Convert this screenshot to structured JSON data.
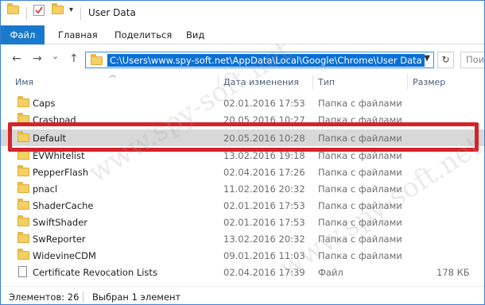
{
  "window": {
    "title": "User Data"
  },
  "ribbon": {
    "tabs": [
      {
        "label": "Файл"
      },
      {
        "label": "Главная"
      },
      {
        "label": "Поделиться"
      },
      {
        "label": "Вид"
      }
    ]
  },
  "nav": {
    "back_icon": "←",
    "forward_icon": "→",
    "recent_icon": "⌄",
    "up_icon": "↑",
    "address": "C:\\Users\\www.spy-soft.net\\AppData\\Local\\Google\\Chrome\\User Data",
    "refresh_icon": "↻",
    "search_placeholder": "Пои"
  },
  "columns": {
    "name": "Имя",
    "date": "Дата изменения",
    "type": "Тип",
    "size": "Размер"
  },
  "rows": [
    {
      "name": "Caps",
      "date": "02.01.2016 17:53",
      "type": "Папка с файлами",
      "size": "",
      "kind": "folder"
    },
    {
      "name": "Crashpad",
      "date": "20.05.2016 10:27",
      "type": "Папка с файлами",
      "size": "",
      "kind": "folder"
    },
    {
      "name": "Default",
      "date": "20.05.2016 10:28",
      "type": "Папка с файлами",
      "size": "",
      "kind": "folder",
      "selected": true
    },
    {
      "name": "EVWhitelist",
      "date": "13.02.2016 19:18",
      "type": "Папка с файлами",
      "size": "",
      "kind": "folder"
    },
    {
      "name": "PepperFlash",
      "date": "02.04.2016 17:26",
      "type": "Папка с файлами",
      "size": "",
      "kind": "folder"
    },
    {
      "name": "pnacl",
      "date": "11.02.2016 20:32",
      "type": "Папка с файлами",
      "size": "",
      "kind": "folder"
    },
    {
      "name": "ShaderCache",
      "date": "02.01.2016 17:53",
      "type": "Папка с файлами",
      "size": "",
      "kind": "folder"
    },
    {
      "name": "SwiftShader",
      "date": "02.01.2016 17:53",
      "type": "Папка с файлами",
      "size": "",
      "kind": "folder"
    },
    {
      "name": "SwReporter",
      "date": "13.02.2016 20:32",
      "type": "Папка с файлами",
      "size": "",
      "kind": "folder"
    },
    {
      "name": "WidevineCDM",
      "date": "09.01.2016 11:03",
      "type": "Папка с файлами",
      "size": "",
      "kind": "folder"
    },
    {
      "name": "Certificate Revocation Lists",
      "date": "02.04.2016 17:39",
      "type": "Файл",
      "size": "178 КБ",
      "kind": "file"
    }
  ],
  "status": {
    "count": "Элементов: 26",
    "selection": "Выбран 1 элемент"
  },
  "watermark": "www.spy-soft.net",
  "colors": {
    "file_tab": "#1979ca",
    "address_highlight": "#0a6fd7",
    "highlight_frame": "#d5232a",
    "selected_row": "#d8d8d8"
  }
}
